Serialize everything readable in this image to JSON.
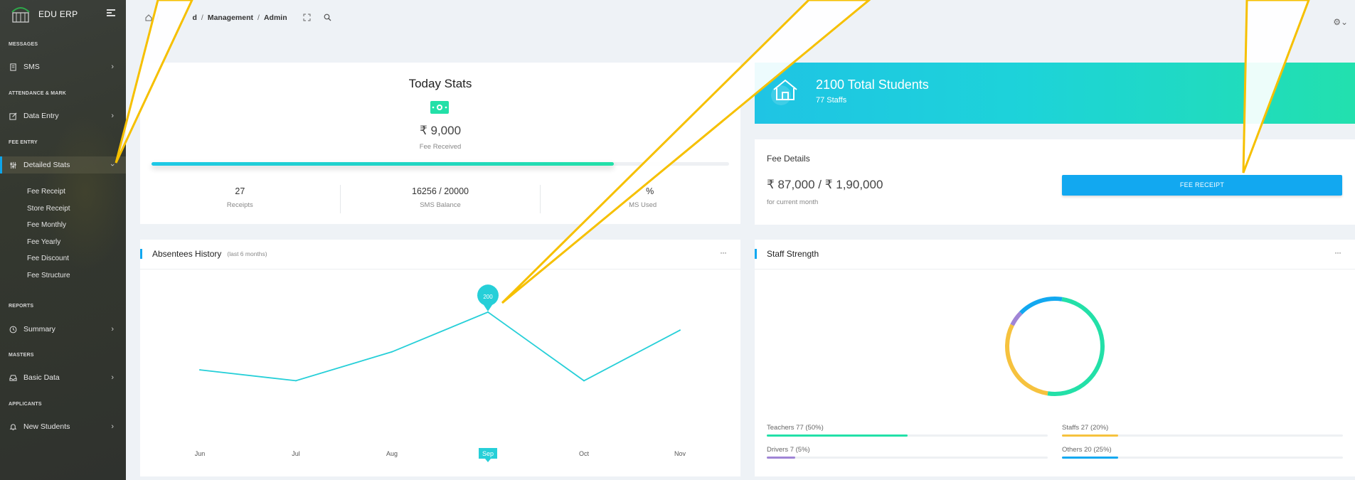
{
  "sidebar": {
    "brand": "EDU ERP",
    "sections": [
      {
        "title": "MESSAGES"
      },
      {
        "title": "ATTENDANCE & MARK"
      },
      {
        "title": "FEE ENTRY"
      },
      {
        "title": "REPORTS"
      },
      {
        "title": "MASTERS"
      },
      {
        "title": "APPLICANTS"
      }
    ],
    "items": [
      {
        "label": "SMS",
        "icon": "document-icon"
      },
      {
        "label": "Data Entry",
        "icon": "edit-icon"
      },
      {
        "label": "Detailed Stats",
        "icon": "sliders-icon"
      },
      {
        "label": "Summary",
        "icon": "clock-icon"
      },
      {
        "label": "Basic Data",
        "icon": "inbox-icon"
      },
      {
        "label": "New Students",
        "icon": "bell-icon"
      }
    ],
    "sub_items": [
      "Fee Receipt",
      "Store Receipt",
      "Fee Monthly",
      "Fee Yearly",
      "Fee Discount",
      "Fee Structure"
    ]
  },
  "header": {
    "breadcrumb": [
      "d",
      "Management",
      "Admin"
    ]
  },
  "today_stats": {
    "title": "Today Stats",
    "amount": "₹ 9,000",
    "amount_label": "Fee Received",
    "progress_fraction": 0.8,
    "stats": [
      {
        "value": "27",
        "label": "Receipts"
      },
      {
        "value": "16256 / 20000",
        "label": "SMS Balance"
      },
      {
        "value": "%",
        "label": "MS Used"
      }
    ]
  },
  "students": {
    "title": "2100 Total Students",
    "subtitle": "77 Staffs"
  },
  "fee_details": {
    "title": "Fee Details",
    "amount": "₹ 87,000 / ₹ 1,90,000",
    "sub": "for current month",
    "button": "FEE RECEIPT"
  },
  "absentees": {
    "title": "Absentees History",
    "subtitle": "(last 6 months)",
    "more": "···"
  },
  "staff": {
    "title": "Staff Strength",
    "more": "···",
    "legend": [
      {
        "label": "Teachers 77 (50%)",
        "fraction": 0.5,
        "color": "#23e0a8"
      },
      {
        "label": "Staffs 27 (20%)",
        "fraction": 0.2,
        "color": "#f6c23e"
      },
      {
        "label": "Drivers 7 (5%)",
        "fraction": 0.1,
        "color": "#a085d6"
      },
      {
        "label": "Others 20 (25%)",
        "fraction": 0.2,
        "color": "#12a8f0"
      }
    ]
  },
  "chart_data": {
    "type": "line",
    "categories": [
      "Jun",
      "Jul",
      "Aug",
      "Sep",
      "Oct",
      "Nov"
    ],
    "values": [
      120,
      105,
      145,
      200,
      105,
      175
    ],
    "highlight": {
      "category": "Sep",
      "label": "200"
    },
    "color": "#26cfd8",
    "ylim": [
      0,
      260
    ],
    "grid": false
  },
  "donut": {
    "segments": [
      {
        "name": "Teachers",
        "value": 50,
        "color": "#23e0a8"
      },
      {
        "name": "Staffs",
        "value": 30,
        "color": "#f6c23e"
      },
      {
        "name": "Drivers",
        "value": 5,
        "color": "#a085d6"
      },
      {
        "name": "Others",
        "value": 15,
        "color": "#12a8f0"
      }
    ]
  },
  "colors": {
    "accent": "#12a8f0",
    "teal": "#23e0a8",
    "overlay_line": "#f6c000"
  }
}
